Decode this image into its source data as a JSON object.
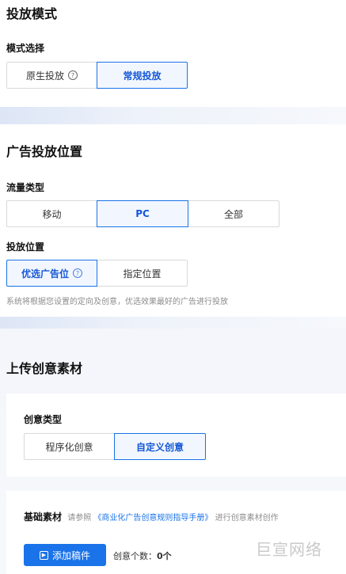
{
  "delivery_mode": {
    "title": "投放模式",
    "mode_label": "模式选择",
    "options": [
      "原生投放",
      "常规投放"
    ],
    "selected": "常规投放"
  },
  "placement": {
    "title": "广告投放位置",
    "traffic_label": "流量类型",
    "traffic_options": [
      "移动",
      "PC",
      "全部"
    ],
    "traffic_selected": "PC",
    "position_label": "投放位置",
    "position_options": [
      "优选广告位",
      "指定位置"
    ],
    "position_selected": "优选广告位",
    "hint": "系统将根据您设置的定向及创意，优选效果最好的广告进行投放"
  },
  "upload": {
    "title": "上传创意素材",
    "creative_type_label": "创意类型",
    "creative_options": [
      "程序化创意",
      "自定义创意"
    ],
    "creative_selected": "自定义创意",
    "basic_label": "基础素材",
    "basic_hint_prefix": "请参照",
    "basic_hint_link": "《商业化广告创意规则指导手册》",
    "basic_hint_suffix": "进行创意素材创作",
    "add_button": "添加稿件",
    "count_label": "创意个数：",
    "count_value": "0个"
  },
  "watermark": "巨宣网络",
  "icons": {
    "help": "question-circle-icon",
    "add": "play-square-icon"
  },
  "colors": {
    "accent": "#1a73e8",
    "border": "#d9d9d9",
    "hint": "#8c8c8c"
  }
}
